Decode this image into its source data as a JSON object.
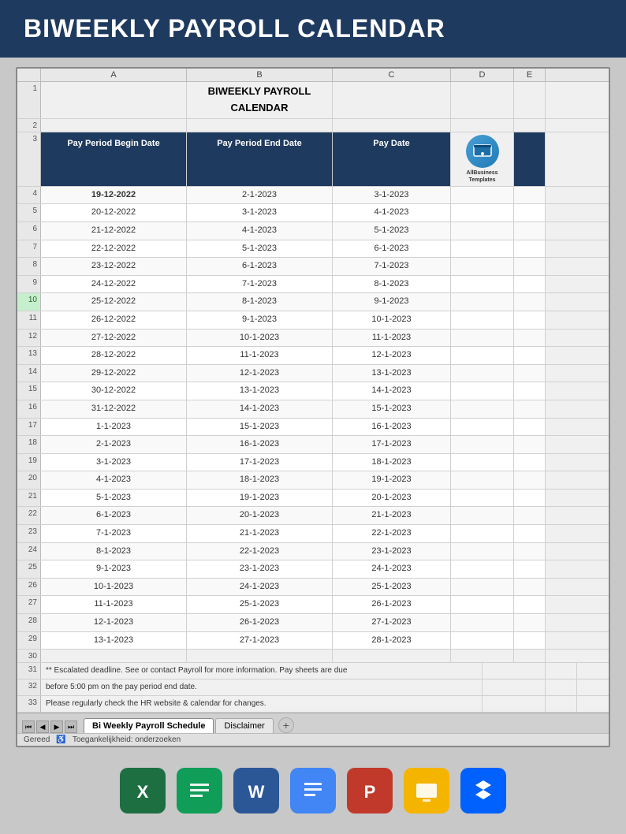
{
  "header": {
    "title": "BIWEEKLY PAYROLL CALENDAR",
    "background": "#1e3a5f",
    "text_color": "#ffffff"
  },
  "spreadsheet": {
    "title_row": "BIWEEKLY PAYROLL CALENDAR",
    "columns": [
      "Pay Period Begin Date",
      "Pay Period End Date",
      "Pay Date"
    ],
    "rows": [
      {
        "begin": "19-12-2022",
        "end": "2-1-2023",
        "pay": "3-1-2023",
        "highlight": true
      },
      {
        "begin": "20-12-2022",
        "end": "3-1-2023",
        "pay": "4-1-2023"
      },
      {
        "begin": "21-12-2022",
        "end": "4-1-2023",
        "pay": "5-1-2023"
      },
      {
        "begin": "22-12-2022",
        "end": "5-1-2023",
        "pay": "6-1-2023"
      },
      {
        "begin": "23-12-2022",
        "end": "6-1-2023",
        "pay": "7-1-2023"
      },
      {
        "begin": "24-12-2022",
        "end": "7-1-2023",
        "pay": "8-1-2023"
      },
      {
        "begin": "25-12-2022",
        "end": "8-1-2023",
        "pay": "9-1-2023"
      },
      {
        "begin": "26-12-2022",
        "end": "9-1-2023",
        "pay": "10-1-2023"
      },
      {
        "begin": "27-12-2022",
        "end": "10-1-2023",
        "pay": "11-1-2023"
      },
      {
        "begin": "28-12-2022",
        "end": "11-1-2023",
        "pay": "12-1-2023"
      },
      {
        "begin": "29-12-2022",
        "end": "12-1-2023",
        "pay": "13-1-2023"
      },
      {
        "begin": "30-12-2022",
        "end": "13-1-2023",
        "pay": "14-1-2023"
      },
      {
        "begin": "31-12-2022",
        "end": "14-1-2023",
        "pay": "15-1-2023"
      },
      {
        "begin": "1-1-2023",
        "end": "15-1-2023",
        "pay": "16-1-2023"
      },
      {
        "begin": "2-1-2023",
        "end": "16-1-2023",
        "pay": "17-1-2023"
      },
      {
        "begin": "3-1-2023",
        "end": "17-1-2023",
        "pay": "18-1-2023"
      },
      {
        "begin": "4-1-2023",
        "end": "18-1-2023",
        "pay": "19-1-2023"
      },
      {
        "begin": "5-1-2023",
        "end": "19-1-2023",
        "pay": "20-1-2023"
      },
      {
        "begin": "6-1-2023",
        "end": "20-1-2023",
        "pay": "21-1-2023"
      },
      {
        "begin": "7-1-2023",
        "end": "21-1-2023",
        "pay": "22-1-2023"
      },
      {
        "begin": "8-1-2023",
        "end": "22-1-2023",
        "pay": "23-1-2023"
      },
      {
        "begin": "9-1-2023",
        "end": "23-1-2023",
        "pay": "24-1-2023"
      },
      {
        "begin": "10-1-2023",
        "end": "24-1-2023",
        "pay": "25-1-2023"
      },
      {
        "begin": "11-1-2023",
        "end": "25-1-2023",
        "pay": "26-1-2023"
      },
      {
        "begin": "12-1-2023",
        "end": "26-1-2023",
        "pay": "27-1-2023"
      },
      {
        "begin": "13-1-2023",
        "end": "27-1-2023",
        "pay": "28-1-2023"
      }
    ],
    "notes": [
      "** Escalated deadline. See  or contact Payroll for more information. Pay sheets are due",
      "before 5:00 pm on the pay period end date.",
      "Please regularly check the HR website & calendar for changes."
    ],
    "logo_lines": [
      "AllBusiness",
      "Templates"
    ],
    "tabs": [
      "Bi Weekly Payroll Schedule",
      "Disclaimer"
    ],
    "status": "Gereed",
    "accessibility": "Toegankelijkheid: onderzoeken",
    "col_headers": [
      "A",
      "B",
      "C",
      "D",
      "E"
    ]
  },
  "app_icons": [
    {
      "name": "Excel",
      "class": "icon-excel"
    },
    {
      "name": "Google Sheets",
      "class": "icon-sheets"
    },
    {
      "name": "Word",
      "class": "icon-word"
    },
    {
      "name": "Google Docs",
      "class": "icon-docs"
    },
    {
      "name": "PowerPoint",
      "class": "icon-ppt"
    },
    {
      "name": "Google Slides",
      "class": "icon-slides"
    },
    {
      "name": "Dropbox",
      "class": "icon-dropbox"
    }
  ]
}
